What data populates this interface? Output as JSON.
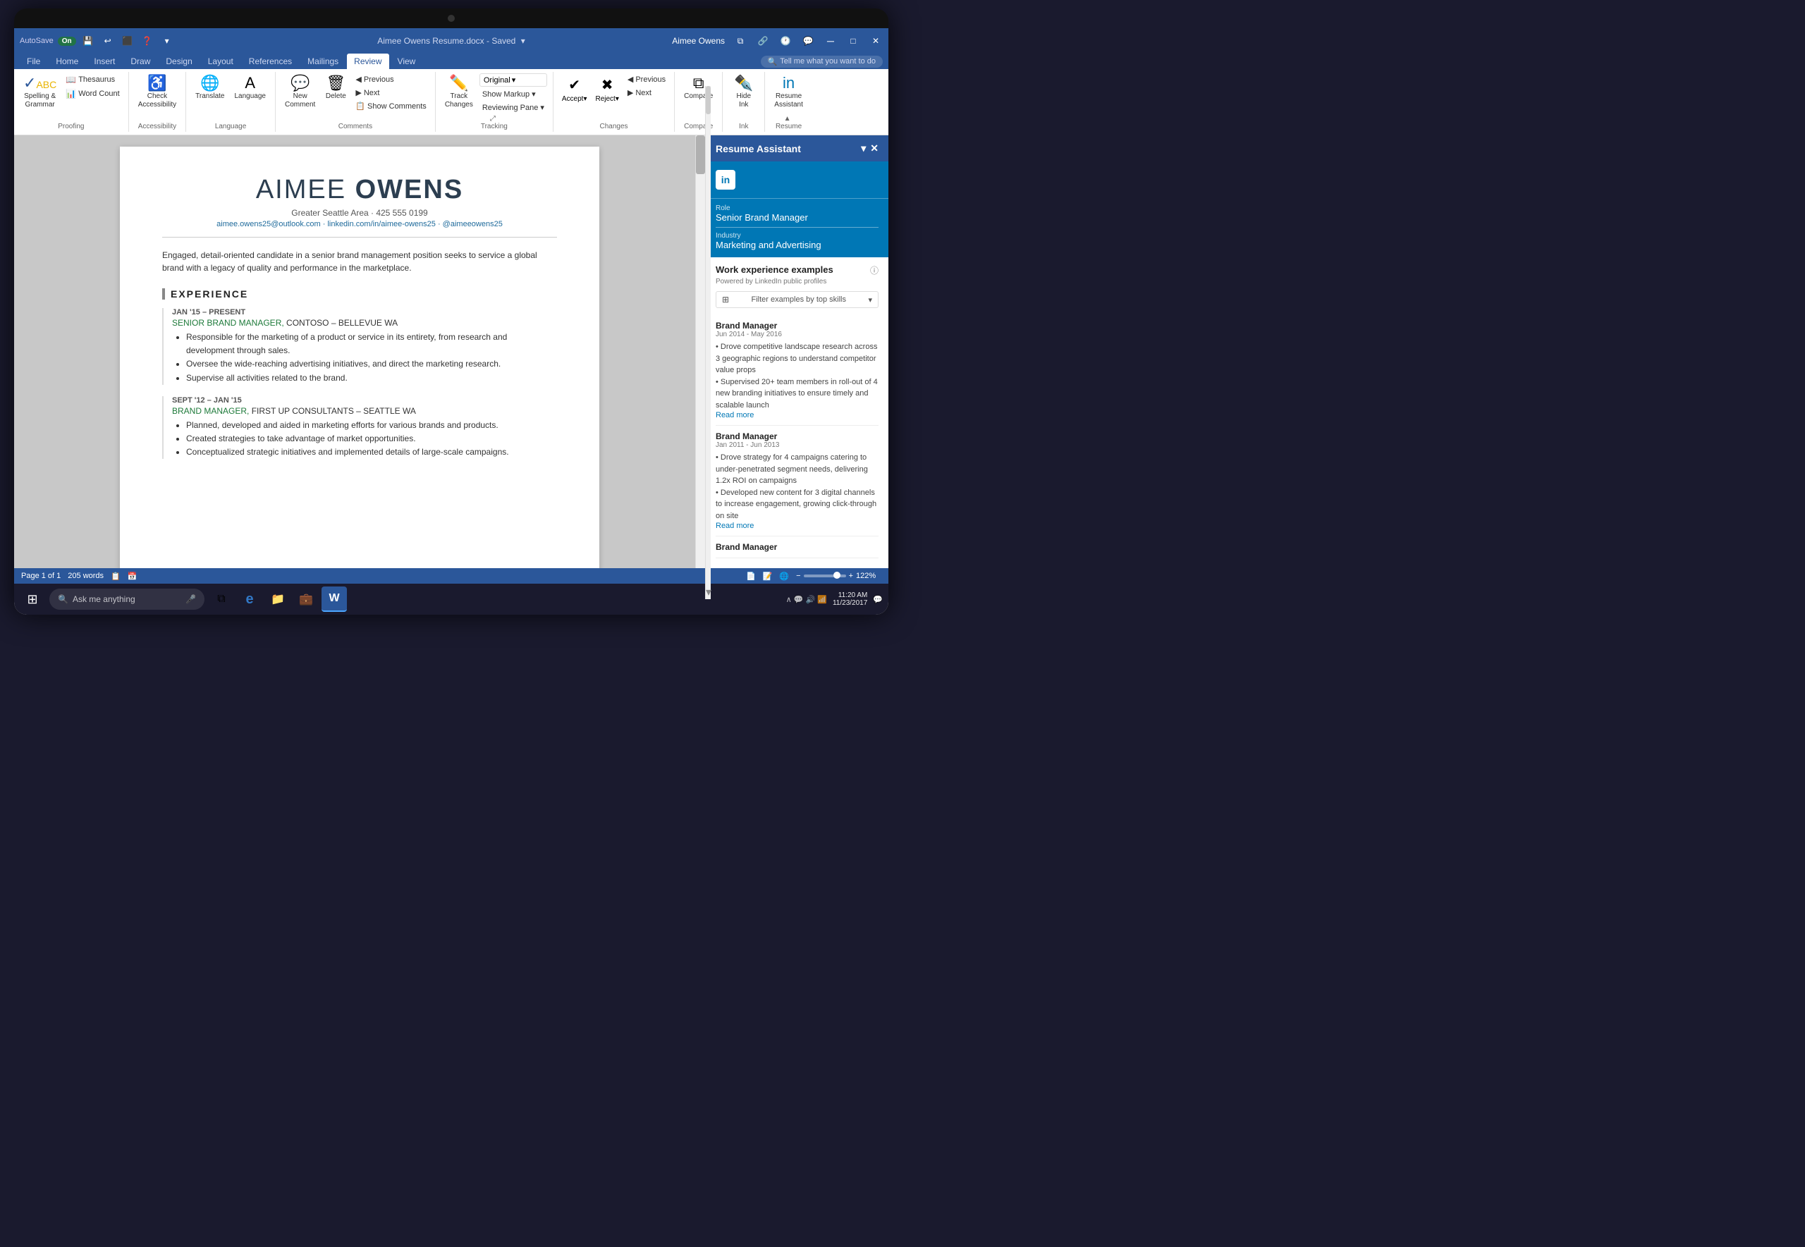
{
  "device": {
    "camera": "camera"
  },
  "titlebar": {
    "autosave_label": "AutoSave",
    "autosave_state": "On",
    "filename": "Aimee Owens Resume.docx",
    "saved_indicator": "– Saved",
    "user_name": "Aimee Owens",
    "title": "Aimee Owens Resume.docx - Saved"
  },
  "ribbon": {
    "tabs": [
      "File",
      "Home",
      "Insert",
      "Draw",
      "Design",
      "Layout",
      "References",
      "Mailings",
      "Review",
      "View"
    ],
    "active_tab": "Review",
    "tell_me": "Tell me what you want to do",
    "groups": {
      "proofing": {
        "label": "Proofing",
        "spelling_grammar": "Spelling &\nGrammar",
        "thesaurus": "Thesaurus",
        "word_count": "Word Count"
      },
      "accessibility": {
        "label": "Accessibility",
        "check_accessibility": "Check\nAccessibility"
      },
      "language": {
        "label": "Language",
        "translate": "Translate",
        "language": "Language"
      },
      "comments": {
        "label": "Comments",
        "new_comment": "New\nComment",
        "delete": "Delete",
        "previous": "Previous",
        "next": "Next",
        "show_comments": "Show Comments"
      },
      "tracking": {
        "label": "Tracking",
        "track_changes": "Track\nChanges",
        "original_dropdown": "Original",
        "show_markup": "Show Markup",
        "reviewing_pane": "Reviewing Pane"
      },
      "changes": {
        "label": "Changes",
        "accept": "Accept",
        "reject": "Reject",
        "previous": "Previous",
        "next": "Next"
      },
      "compare": {
        "label": "Compare",
        "compare": "Compare"
      },
      "ink": {
        "label": "Ink",
        "hide_ink": "Hide\nInk"
      },
      "resume": {
        "label": "Resume",
        "resume_assistant": "Resume\nAssistant"
      }
    }
  },
  "document": {
    "name": {
      "first": "AIMEE ",
      "last": "OWENS"
    },
    "location": "Greater Seattle Area · 425 555 0199",
    "links": "aimee.owens25@outlook.com · linkedin.com/in/aimee-owens25 · @aimeeowens25",
    "summary": "Engaged, detail-oriented candidate in a senior brand management position seeks to service a global brand with a legacy of quality and performance in the marketplace.",
    "experience_title": "EXPERIENCE",
    "jobs": [
      {
        "dates": "JAN '15 – PRESENT",
        "title": "SENIOR BRAND MANAGER,",
        "company": " CONTOSO – BELLEVUE WA",
        "bullets": [
          "Responsible for the marketing of a product or service in its entirety, from research and development through sales.",
          "Oversee the wide-reaching advertising initiatives, and direct the marketing research.",
          "Supervise all activities related to the brand."
        ]
      },
      {
        "dates": "SEPT '12 – JAN '15",
        "title": "BRAND MANAGER,",
        "company": " FIRST UP CONSULTANTS – SEATTLE WA",
        "bullets": [
          "Planned, developed and aided in marketing efforts for various brands and products.",
          "Created strategies to take advantage of market opportunities.",
          "Conceptualized strategic initiatives and implemented details of large-scale campaigns."
        ]
      }
    ]
  },
  "resume_panel": {
    "title": "Resume Assistant",
    "linkedin_label": "in",
    "role_label": "Role",
    "role_value": "Senior Brand Manager",
    "industry_label": "Industry",
    "industry_value": "Marketing and Advertising",
    "work_experience_label": "Work experience examples",
    "powered_by": "Powered by LinkedIn public profiles",
    "filter_label": "Filter examples by top skills",
    "experiences": [
      {
        "title": "Brand Manager",
        "dates": "Jun 2014 - May 2016",
        "bullets": "• Drove competitive landscape research across 3 geographic regions to understand competitor value props\n• Supervised 20+ team members in roll-out of 4 new branding initiatives to ensure timely and scalable launch",
        "read_more": "Read more"
      },
      {
        "title": "Brand Manager",
        "dates": "Jan 2011 - Jun 2013",
        "bullets": "• Drove strategy for 4 campaigns catering to under-penetrated segment needs, delivering 1.2x ROI on campaigns\n• Developed new content for 3 digital channels to increase engagement, growing click-through on site",
        "read_more": "Read more"
      },
      {
        "title": "Brand Manager",
        "dates": "",
        "bullets": "",
        "read_more": ""
      }
    ]
  },
  "statusbar": {
    "page": "Page 1 of 1",
    "words": "205 words",
    "zoom": "122%"
  },
  "taskbar": {
    "search_placeholder": "Ask me anything",
    "time": "11:20 AM",
    "date": "11/23/2017",
    "icons": [
      "⊞",
      "🔍",
      "⧉",
      "e",
      "📁",
      "💼",
      "W"
    ]
  }
}
